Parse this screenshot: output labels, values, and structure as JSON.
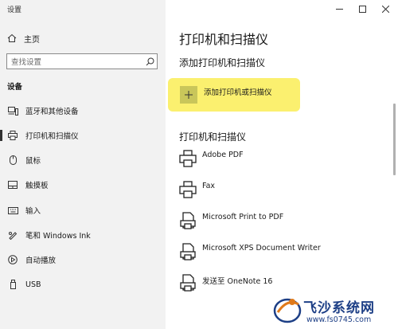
{
  "window": {
    "title": "设置"
  },
  "sidebar": {
    "home_label": "主页",
    "search_placeholder": "查找设置",
    "section": "设备",
    "items": [
      {
        "label": "蓝牙和其他设备",
        "icon": "bluetooth-devices-icon"
      },
      {
        "label": "打印机和扫描仪",
        "icon": "printer-icon",
        "selected": true
      },
      {
        "label": "鼠标",
        "icon": "mouse-icon"
      },
      {
        "label": "触摸板",
        "icon": "touchpad-icon"
      },
      {
        "label": "输入",
        "icon": "keyboard-icon"
      },
      {
        "label": "笔和 Windows Ink",
        "icon": "pen-icon"
      },
      {
        "label": "自动播放",
        "icon": "autoplay-icon"
      },
      {
        "label": "USB",
        "icon": "usb-icon"
      }
    ]
  },
  "main": {
    "title": "打印机和扫描仪",
    "add_section_title": "添加打印机和扫描仪",
    "add_button_label": "添加打印机或扫描仪",
    "list_section_title": "打印机和扫描仪",
    "printers": [
      {
        "name": "Adobe PDF",
        "icon": "printer-icon"
      },
      {
        "name": "Fax",
        "icon": "printer-icon"
      },
      {
        "name": "Microsoft Print to PDF",
        "icon": "document-printer-icon"
      },
      {
        "name": "Microsoft XPS Document Writer",
        "icon": "document-printer-icon"
      },
      {
        "name": "发送至 OneNote 16",
        "icon": "document-printer-icon"
      }
    ]
  },
  "watermark": {
    "title": "飞沙系统网",
    "url": "www.fs0745.com"
  },
  "colors": {
    "sidebar_bg": "#f2f2f2",
    "highlight": "#fbf06f",
    "watermark": "#1d3f86"
  }
}
